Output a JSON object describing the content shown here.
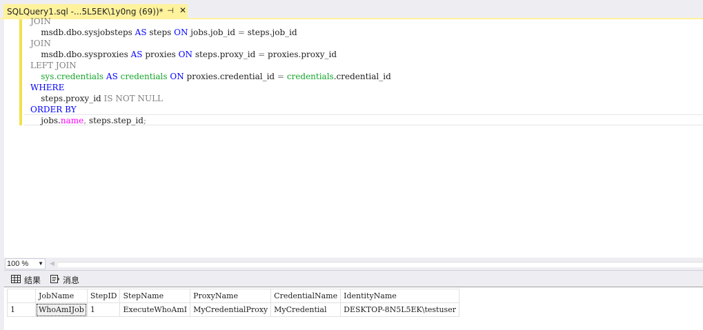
{
  "tab": {
    "title": "SQLQuery1.sql -...5L5EK\\1y0ng (69))*",
    "pin_icon": "pin-icon",
    "close_icon": "close-icon"
  },
  "editor": {
    "code_lines": [
      "JOIN",
      "    msdb.dbo.sysjobsteps AS steps ON jobs.job_id = steps.job_id",
      "JOIN",
      "    msdb.dbo.sysproxies AS proxies ON steps.proxy_id = proxies.proxy_id",
      "LEFT JOIN",
      "    sys.credentials AS credentials ON proxies.credential_id = credentials.credential_id",
      "WHERE",
      "    steps.proxy_id IS NOT NULL",
      "ORDER BY",
      "    jobs.name, steps.step_id;"
    ],
    "tokens": {
      "l0_join": "JOIN",
      "l1_a": "msdb.dbo.sysjobsteps",
      "l1_as": "AS",
      "l1_b": "steps",
      "l1_on": "ON",
      "l1_c": "jobs.job_id",
      "l1_eq": "=",
      "l1_d": "steps.job_id",
      "l2_join": "JOIN",
      "l3_a": "msdb.dbo.sysproxies",
      "l3_as": "AS",
      "l3_b": "proxies",
      "l3_on": "ON",
      "l3_c": "steps.proxy_id",
      "l3_eq": "=",
      "l3_d": "proxies.proxy_id",
      "l4_left": "LEFT",
      "l4_join": "JOIN",
      "l5_sys": "sys",
      "l5_dot": ".",
      "l5_cred": "credentials",
      "l5_as": "AS",
      "l5_alias": "credentials",
      "l5_on": "ON",
      "l5_c": "proxies.credential_id",
      "l5_eq": "=",
      "l5_d": "credentials",
      "l5_e": ".credential_id",
      "l6_where": "WHERE",
      "l7_a": "steps.proxy_id",
      "l7_is": "IS NOT NULL",
      "l8_order": "ORDER BY",
      "l9_a": "jobs.",
      "l9_name": "name",
      "l9_comma": ",",
      "l9_b": "steps.step_id",
      "l9_semi": ";"
    }
  },
  "zoom": {
    "value": "100 %"
  },
  "results_tabs": [
    {
      "label": "结果",
      "icon": "grid-icon"
    },
    {
      "label": "消息",
      "icon": "messages-icon"
    }
  ],
  "grid": {
    "columns": [
      "JobName",
      "StepID",
      "StepName",
      "ProxyName",
      "CredentialName",
      "IdentityName"
    ],
    "rows": [
      {
        "num": "1",
        "cells": [
          "WhoAmIJob",
          "1",
          "ExecuteWhoAmI",
          "MyCredentialProxy",
          "MyCredential",
          "DESKTOP-8N5L5EK\\testuser"
        ]
      }
    ]
  },
  "colors": {
    "tab_active": "#fff29d",
    "keyword": "#0000ff",
    "system_object": "#12a52a",
    "operator_gray": "#808080",
    "function_magenta": "#ff00ff",
    "change_bar": "#f2e14b"
  }
}
